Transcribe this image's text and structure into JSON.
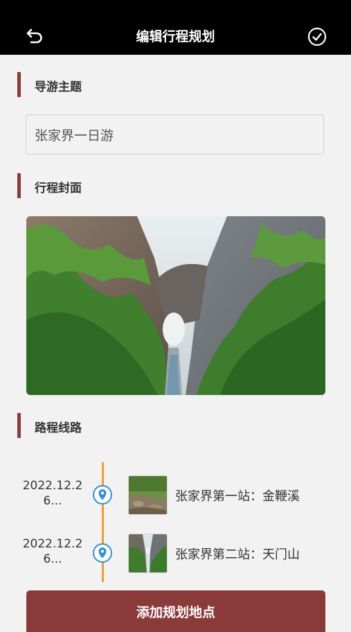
{
  "header": {
    "title": "编辑行程规划",
    "back_icon": "undo-arrow-icon",
    "confirm_icon": "check-circle-icon"
  },
  "sections": {
    "theme_label": "导游主题",
    "cover_label": "行程封面",
    "route_label": "路程线路"
  },
  "theme": {
    "value": "张家界一日游"
  },
  "route": {
    "stops": [
      {
        "date_line1": "2022.12.2",
        "date_line2": "6...",
        "name": "张家界第一站：金鞭溪"
      },
      {
        "date_line1": "2022.12.2",
        "date_line2": "6...",
        "name": "张家界第二站：天门山"
      }
    ]
  },
  "actions": {
    "add_label": "添加规划地点"
  },
  "colors": {
    "accent": "#8b3a3a",
    "timeline": "#f29a2e",
    "pin": "#2f8fe0",
    "topbar": "#000000"
  }
}
